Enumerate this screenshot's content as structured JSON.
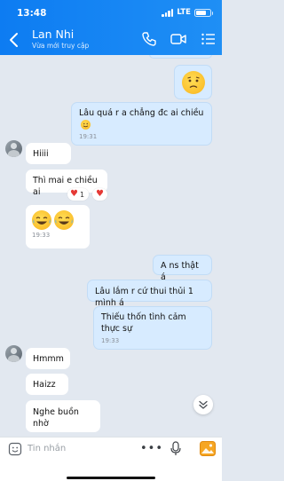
{
  "status": {
    "time": "13:48",
    "network": "LTE"
  },
  "header": {
    "title": "Lan Nhi",
    "subtitle": "Vừa mới truy cập"
  },
  "messages": {
    "m1_text": "Lâu quá r a chẳng đc ai chiều",
    "m1_time": "19:31",
    "m2_text": "Hiiii",
    "m3_text": "Thì mai e chiều ai",
    "m3_reaction_count": "1",
    "m4_time": "19:33",
    "m5_text": "A ns thật á",
    "m6_text": "Lâu lắm r cứ thui thủi 1 mình á",
    "m7_text": "Thiếu thốn tình cảm thực sự",
    "m7_time": "19:33",
    "m8_text": "Hmmm",
    "m9_text": "Haizz",
    "m10_text": "Nghe buồn nhờ"
  },
  "input": {
    "placeholder": "Tin nhắn"
  },
  "icons": {
    "back": "chevron-left-icon",
    "call": "phone-icon",
    "video": "video-camera-icon",
    "menu": "list-menu-icon",
    "sticker": "sticker-icon",
    "more": "more-dots-icon",
    "mic": "microphone-icon",
    "image": "image-icon",
    "scroll": "chevron-double-down-icon"
  },
  "colors": {
    "header": "#0d7cf2",
    "outgoing_bubble": "#d7ebff",
    "incoming_bubble": "#ffffff",
    "chat_background": "#e2e8f0"
  }
}
